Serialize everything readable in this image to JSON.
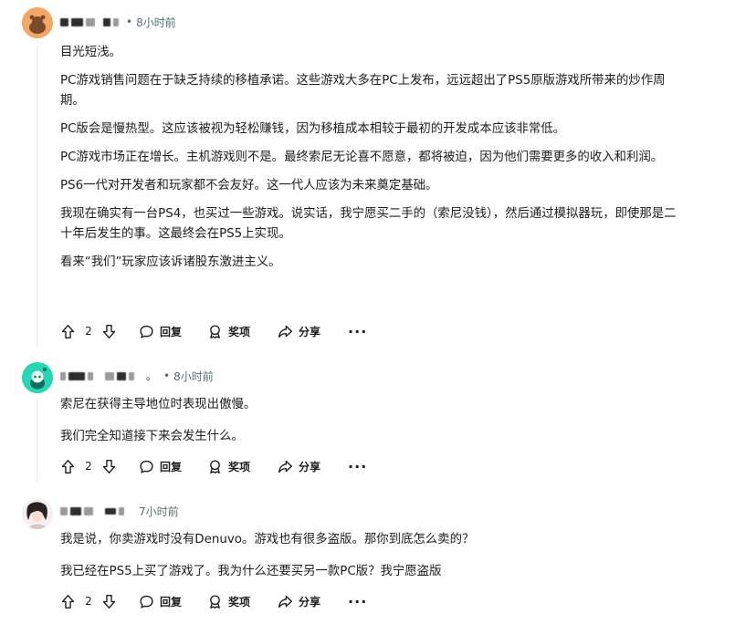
{
  "comments": [
    {
      "time": "8小时前",
      "paragraphs": [
        "目光短浅。",
        "PC游戏销售问题在于缺乏持续的移植承诺。这些游戏大多在PC上发布，远远超出了PS5原版游戏所带来的炒作周期。",
        "PC版会是慢热型。这应该被视为轻松赚钱，因为移植成本相较于最初的开发成本应该非常低。",
        "PC游戏市场正在增长。主机游戏则不是。最终索尼无论喜不愿意，都将被迫，因为他们需要更多的收入和利润。",
        "PS6一代对开发者和玩家都不会友好。这一代人应该为未来奠定基础。",
        "我现在确实有一台PS4，也买过一些游戏。说实话，我宁愿买二手的（索尼没钱），然后通过模拟器玩，即使那是二十年后发生的事。这最终会在PS5上实现。",
        "看来“我们”玩家应该诉诸股东激进主义。"
      ],
      "votes": "2"
    },
    {
      "time": "8小时前",
      "paragraphs": [
        "索尼在获得主导地位时表现出傲慢。",
        "我们完全知道接下来会发生什么。"
      ],
      "votes": "2"
    },
    {
      "time": "7小时前",
      "paragraphs": [
        "我是说，你卖游戏时没有Denuvo。游戏也有很多盗版。那你到底怎么卖的？",
        "我已经在PS5上买了游戏了。我为什么还要买另一款PC版？我宁愿盗版"
      ],
      "votes": "2"
    }
  ],
  "actions": {
    "reply": "回复",
    "award": "奖项",
    "share": "分享",
    "more": "···"
  },
  "separator": "•",
  "author_suffix": "。",
  "icons": [
    "upvote-icon",
    "downvote-icon",
    "reply-icon",
    "award-icon",
    "share-icon",
    "more-icon"
  ],
  "colors": {
    "meta": "#576f76",
    "text": "#1c1c1c",
    "avatar1": "#f2a766",
    "avatar2": "#27d7b4"
  }
}
